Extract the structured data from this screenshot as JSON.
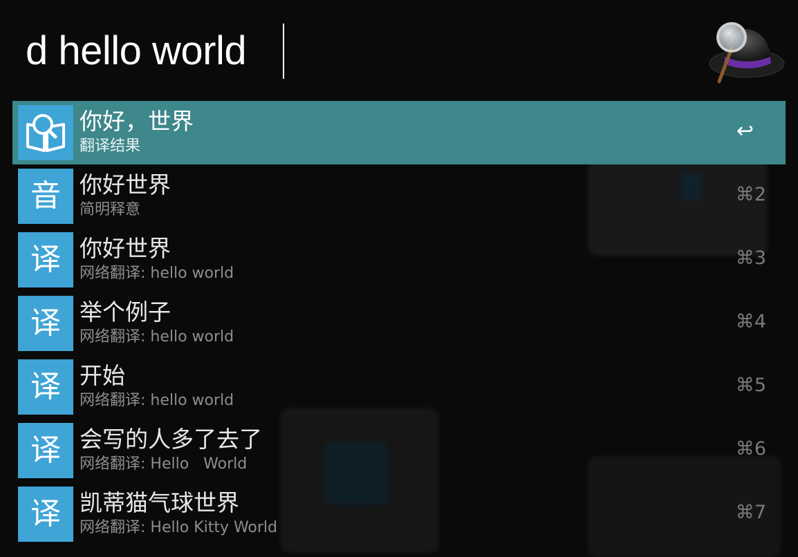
{
  "search": {
    "query": "d hello world"
  },
  "app": {
    "icon": "alfred-hat-magnifier-icon"
  },
  "results": [
    {
      "title": "你好，世界",
      "subtitle": "翻译结果",
      "icon": "translate-book-icon",
      "icon_glyph": "",
      "shortcut": "↩",
      "selected": true
    },
    {
      "title": "你好世界",
      "subtitle": "简明释意",
      "icon": "pronunciation-icon",
      "icon_glyph": "音",
      "shortcut": "⌘2",
      "selected": false
    },
    {
      "title": "你好世界",
      "subtitle": "网络翻译: hello world",
      "icon": "translate-icon",
      "icon_glyph": "译",
      "shortcut": "⌘3",
      "selected": false
    },
    {
      "title": "举个例子",
      "subtitle": "网络翻译: hello world",
      "icon": "translate-icon",
      "icon_glyph": "译",
      "shortcut": "⌘4",
      "selected": false
    },
    {
      "title": "开始",
      "subtitle": "网络翻译: hello world",
      "icon": "translate-icon",
      "icon_glyph": "译",
      "shortcut": "⌘5",
      "selected": false
    },
    {
      "title": "会写的人多了去了",
      "subtitle": "网络翻译: Hello   World",
      "icon": "translate-icon",
      "icon_glyph": "译",
      "shortcut": "⌘6",
      "selected": false
    },
    {
      "title": "凯蒂猫气球世界",
      "subtitle": "网络翻译: Hello Kitty World",
      "icon": "translate-icon",
      "icon_glyph": "译",
      "shortcut": "⌘7",
      "selected": false
    }
  ],
  "colors": {
    "selected_row": "#3e878b",
    "icon_tile": "#3fa4d6",
    "background": "#0a0a0a"
  }
}
